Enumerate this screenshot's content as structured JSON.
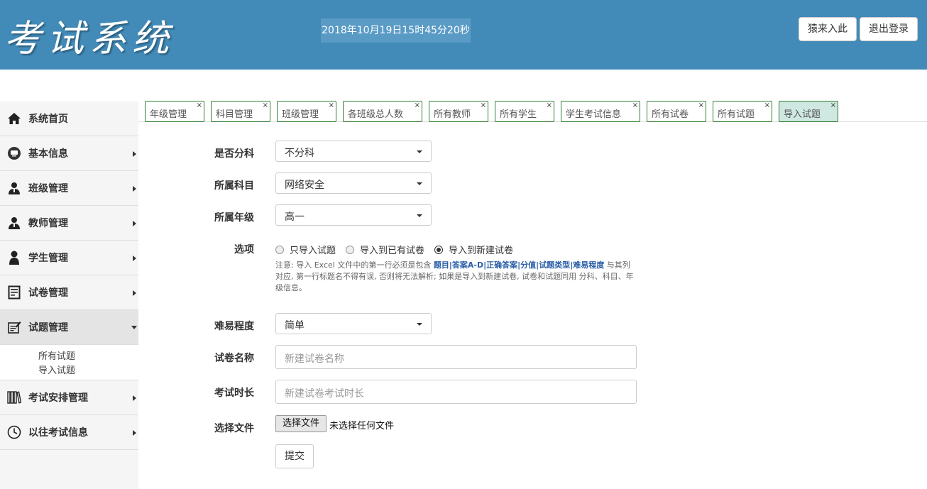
{
  "header": {
    "logo": "考试系统",
    "clock": "2018年10月19日15时45分20秒",
    "user_button": "猿来入此",
    "logout_button": "退出登录"
  },
  "sidebar": {
    "items": [
      {
        "label": "系统首页",
        "icon": "home-icon"
      },
      {
        "label": "基本信息",
        "icon": "monitor-icon"
      },
      {
        "label": "班级管理",
        "icon": "user-icon"
      },
      {
        "label": "教师管理",
        "icon": "user-icon"
      },
      {
        "label": "学生管理",
        "icon": "user-icon"
      },
      {
        "label": "试卷管理",
        "icon": "document-icon"
      },
      {
        "label": "试题管理",
        "icon": "edit-icon"
      },
      {
        "label": "考试安排管理",
        "icon": "books-icon"
      },
      {
        "label": "以往考试信息",
        "icon": "clock-icon"
      }
    ],
    "subitems": [
      "所有试题",
      "导入试题"
    ]
  },
  "tabs": [
    "年级管理",
    "科目管理",
    "班级管理",
    "各班级总人数",
    "所有教师",
    "所有学生",
    "学生考试信息",
    "所有试卷",
    "所有试题",
    "导入试题"
  ],
  "tab_close": "×",
  "form": {
    "division_label": "是否分科",
    "division_value": "不分科",
    "subject_label": "所属科目",
    "subject_value": "网络安全",
    "grade_label": "所属年级",
    "grade_value": "高一",
    "options_label": "选项",
    "options": [
      "只导入试题",
      "导入到已有试卷",
      "导入到新建试卷"
    ],
    "selected_option": 2,
    "note": {
      "prefix": "注意: 导入 Excel 文件中的第一行必须是包含 ",
      "fields": [
        "题目",
        "答案A-D",
        "正确答案",
        "分值",
        "试题类型",
        "难易程度"
      ],
      "separator": "|",
      "suffix": " 与其列对应, 第一行标题名不得有误, 否则将无法解析; 如果是导入到新建试卷, 试卷和试题同用 分科、科目、年级信息。"
    },
    "difficulty_label": "难易程度",
    "difficulty_value": "简单",
    "paper_name_label": "试卷名称",
    "paper_name_placeholder": "新建试卷名称",
    "duration_label": "考试时长",
    "duration_placeholder": "新建试卷考试时长",
    "file_label": "选择文件",
    "file_button": "选择文件",
    "file_status": "未选择任何文件",
    "submit": "提交"
  },
  "colors": {
    "header_bg": "#428bb9",
    "tab_border": "#2e7d32",
    "active_tab_bg": "#cfe8e1",
    "note_highlight": "#2a5ea8"
  }
}
